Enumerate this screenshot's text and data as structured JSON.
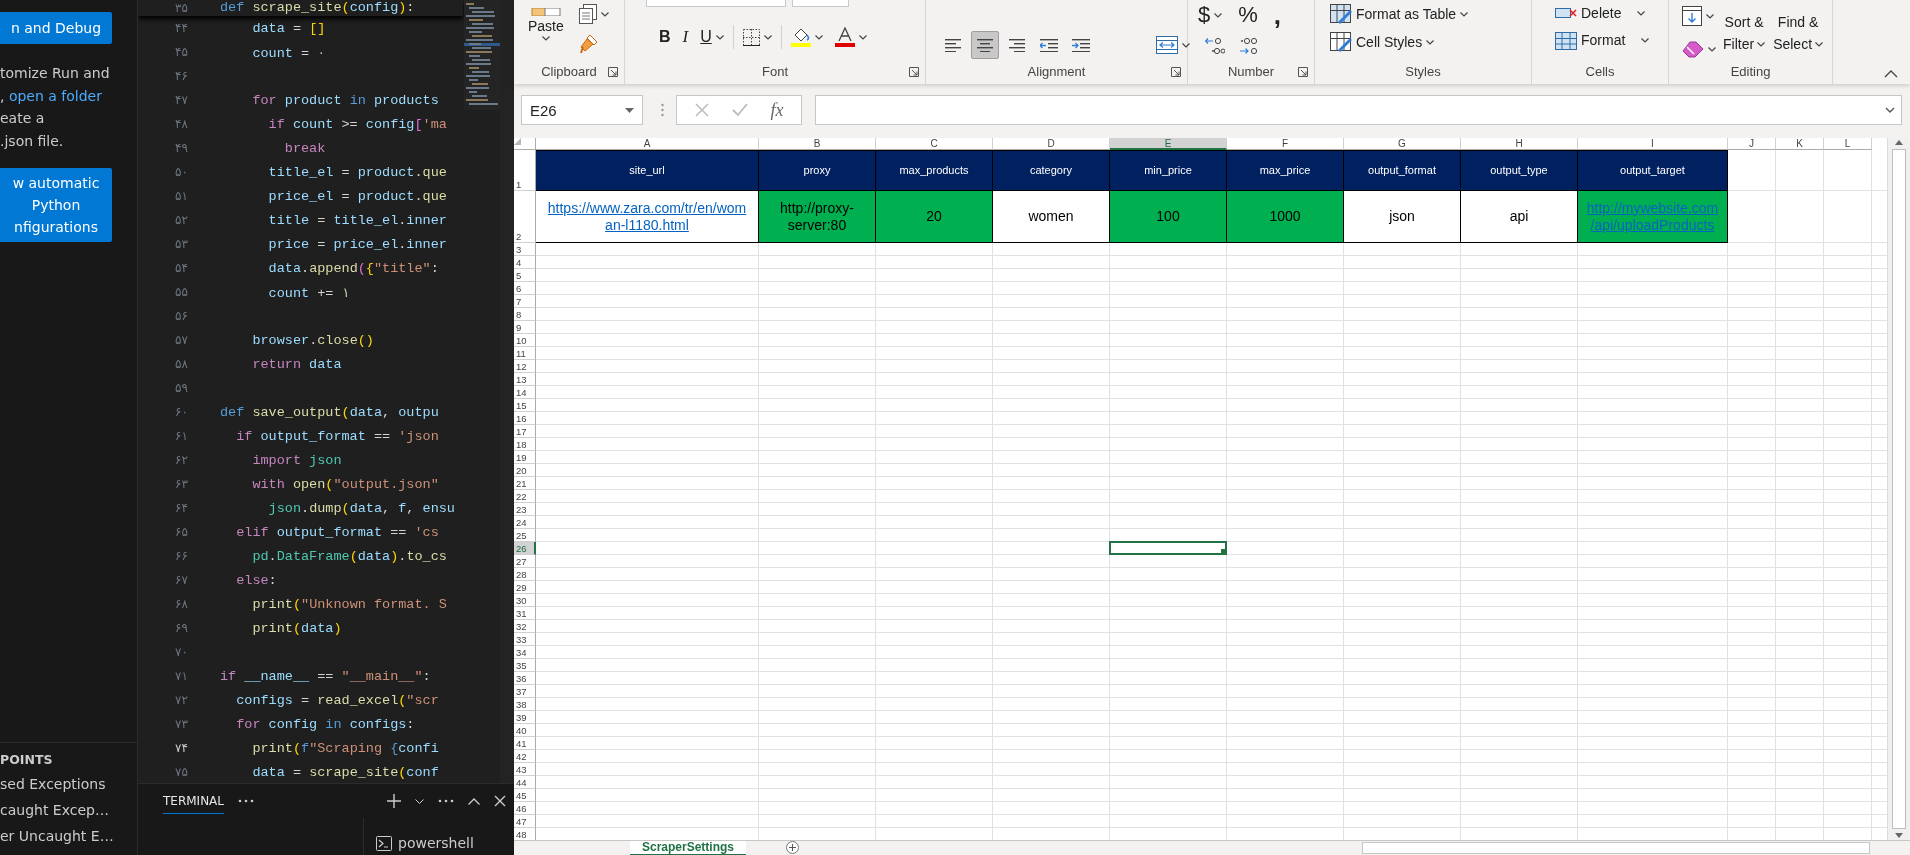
{
  "vscode": {
    "sidebar": {
      "buttons": [
        {
          "lines": [
            "n and Debug"
          ]
        },
        {
          "lines": [
            "w automatic",
            "Python",
            "nfigurations"
          ]
        }
      ],
      "help_text": [
        [
          {
            "kind": "text",
            "text": "tomize Run and"
          }
        ],
        [
          {
            "kind": "text",
            "text": ", "
          },
          {
            "kind": "link",
            "text": "open a folder"
          }
        ],
        [
          {
            "kind": "text",
            "text": "eate a"
          }
        ],
        [
          {
            "kind": "text",
            "text": ".json file."
          }
        ]
      ],
      "breakpoints": {
        "header": "POINTS",
        "items": [
          "sed Exceptions",
          "caught Excep…",
          "er Uncaught E…"
        ]
      }
    },
    "editor": {
      "sticky": {
        "number": "۳۵",
        "tokens": [
          {
            "kind": "kw",
            "text": "def"
          },
          {
            "kind": "fn",
            "text": " scrape_site"
          },
          {
            "kind": "br1",
            "text": "("
          },
          {
            "kind": "var",
            "text": "config"
          },
          {
            "kind": "br1",
            "text": ")"
          },
          {
            "kind": "op",
            "text": ":"
          }
        ]
      },
      "lines": [
        {
          "number": "۴۴",
          "current": false,
          "tokens": [
            {
              "kind": "var",
              "text": "    data"
            },
            {
              "kind": "op",
              "text": " = "
            },
            {
              "kind": "br1",
              "text": "[]"
            }
          ]
        },
        {
          "number": "۴۵",
          "current": false,
          "tokens": [
            {
              "kind": "var",
              "text": "    count"
            },
            {
              "kind": "op",
              "text": " = "
            },
            {
              "kind": "num",
              "text": "۰"
            }
          ]
        },
        {
          "number": "۴۶",
          "current": false
        },
        {
          "number": "۴۷",
          "current": false,
          "tokens": [
            {
              "kind": "ctl",
              "text": "    for"
            },
            {
              "kind": "var",
              "text": " product"
            },
            {
              "kind": "kw",
              "text": " in"
            },
            {
              "kind": "var",
              "text": " products"
            }
          ]
        },
        {
          "number": "۴۸",
          "current": false,
          "tokens": [
            {
              "kind": "ctl",
              "text": "      if"
            },
            {
              "kind": "var",
              "text": " count"
            },
            {
              "kind": "op",
              "text": " >= "
            },
            {
              "kind": "var",
              "text": "config"
            },
            {
              "kind": "br2",
              "text": "["
            },
            {
              "kind": "str",
              "text": "'ma"
            }
          ]
        },
        {
          "number": "۴۹",
          "current": false,
          "tokens": [
            {
              "kind": "ctl",
              "text": "        break"
            }
          ]
        },
        {
          "number": "۵۰",
          "current": false,
          "tokens": [
            {
              "kind": "var",
              "text": "      title_el"
            },
            {
              "kind": "op",
              "text": " = "
            },
            {
              "kind": "var",
              "text": "product"
            },
            {
              "kind": "op",
              "text": "."
            },
            {
              "kind": "fn",
              "text": "que"
            }
          ]
        },
        {
          "number": "۵۱",
          "current": false,
          "tokens": [
            {
              "kind": "var",
              "text": "      price_el"
            },
            {
              "kind": "op",
              "text": " = "
            },
            {
              "kind": "var",
              "text": "product"
            },
            {
              "kind": "op",
              "text": "."
            },
            {
              "kind": "fn",
              "text": "que"
            }
          ]
        },
        {
          "number": "۵۲",
          "current": false,
          "tokens": [
            {
              "kind": "var",
              "text": "      title"
            },
            {
              "kind": "op",
              "text": " = "
            },
            {
              "kind": "var",
              "text": "title_el"
            },
            {
              "kind": "op",
              "text": "."
            },
            {
              "kind": "var",
              "text": "inner"
            }
          ]
        },
        {
          "number": "۵۳",
          "current": false,
          "tokens": [
            {
              "kind": "var",
              "text": "      price"
            },
            {
              "kind": "op",
              "text": " = "
            },
            {
              "kind": "var",
              "text": "price_el"
            },
            {
              "kind": "op",
              "text": "."
            },
            {
              "kind": "var",
              "text": "inner"
            }
          ]
        },
        {
          "number": "۵۴",
          "current": false,
          "tokens": [
            {
              "kind": "var",
              "text": "      data"
            },
            {
              "kind": "op",
              "text": "."
            },
            {
              "kind": "fn",
              "text": "append"
            },
            {
              "kind": "br2",
              "text": "("
            },
            {
              "kind": "br1",
              "text": "{"
            },
            {
              "kind": "str",
              "text": "\"title\""
            },
            {
              "kind": "op",
              "text": ":"
            }
          ]
        },
        {
          "number": "۵۵",
          "current": false,
          "tokens": [
            {
              "kind": "var",
              "text": "      count"
            },
            {
              "kind": "op",
              "text": " += "
            },
            {
              "kind": "num",
              "text": "۱"
            }
          ]
        },
        {
          "number": "۵۶",
          "current": false
        },
        {
          "number": "۵۷",
          "current": false,
          "tokens": [
            {
              "kind": "var",
              "text": "    browser"
            },
            {
              "kind": "op",
              "text": "."
            },
            {
              "kind": "fn",
              "text": "close"
            },
            {
              "kind": "br1",
              "text": "()"
            }
          ]
        },
        {
          "number": "۵۸",
          "current": false,
          "tokens": [
            {
              "kind": "ctl",
              "text": "    return"
            },
            {
              "kind": "var",
              "text": " data"
            }
          ]
        },
        {
          "number": "۵۹",
          "current": false
        },
        {
          "number": "۶۰",
          "current": false,
          "tokens": [
            {
              "kind": "kw",
              "text": "def"
            },
            {
              "kind": "fn",
              "text": " save_output"
            },
            {
              "kind": "br1",
              "text": "("
            },
            {
              "kind": "var",
              "text": "data"
            },
            {
              "kind": "op",
              "text": ", "
            },
            {
              "kind": "var",
              "text": "outpu"
            }
          ]
        },
        {
          "number": "۶۱",
          "current": false,
          "tokens": [
            {
              "kind": "ctl",
              "text": "  if"
            },
            {
              "kind": "var",
              "text": " output_format"
            },
            {
              "kind": "op",
              "text": " == "
            },
            {
              "kind": "str",
              "text": "'json"
            }
          ]
        },
        {
          "number": "۶۲",
          "current": false,
          "tokens": [
            {
              "kind": "ctl",
              "text": "    import"
            },
            {
              "kind": "cls",
              "text": " json"
            }
          ]
        },
        {
          "number": "۶۳",
          "current": false,
          "tokens": [
            {
              "kind": "ctl",
              "text": "    with"
            },
            {
              "kind": "fn",
              "text": " open"
            },
            {
              "kind": "br1",
              "text": "("
            },
            {
              "kind": "str",
              "text": "\"output.json\""
            }
          ]
        },
        {
          "number": "۶۴",
          "current": false,
          "tokens": [
            {
              "kind": "cls",
              "text": "      json"
            },
            {
              "kind": "op",
              "text": "."
            },
            {
              "kind": "fn",
              "text": "dump"
            },
            {
              "kind": "br1",
              "text": "("
            },
            {
              "kind": "var",
              "text": "data"
            },
            {
              "kind": "op",
              "text": ", "
            },
            {
              "kind": "var",
              "text": "f"
            },
            {
              "kind": "op",
              "text": ", "
            },
            {
              "kind": "var",
              "text": "ensu"
            }
          ]
        },
        {
          "number": "۶۵",
          "current": false,
          "tokens": [
            {
              "kind": "ctl",
              "text": "  elif"
            },
            {
              "kind": "var",
              "text": " output_format"
            },
            {
              "kind": "op",
              "text": " == "
            },
            {
              "kind": "str",
              "text": "'cs"
            }
          ]
        },
        {
          "number": "۶۶",
          "current": false,
          "tokens": [
            {
              "kind": "cls",
              "text": "    pd"
            },
            {
              "kind": "op",
              "text": "."
            },
            {
              "kind": "cls",
              "text": "DataFrame"
            },
            {
              "kind": "br1",
              "text": "("
            },
            {
              "kind": "var",
              "text": "data"
            },
            {
              "kind": "br1",
              "text": ")"
            },
            {
              "kind": "op",
              "text": "."
            },
            {
              "kind": "fn",
              "text": "to_cs"
            }
          ]
        },
        {
          "number": "۶۷",
          "current": false,
          "tokens": [
            {
              "kind": "ctl",
              "text": "  else"
            },
            {
              "kind": "op",
              "text": ":"
            }
          ]
        },
        {
          "number": "۶۸",
          "current": false,
          "tokens": [
            {
              "kind": "fn",
              "text": "    print"
            },
            {
              "kind": "br1",
              "text": "("
            },
            {
              "kind": "str",
              "text": "\"Unknown format. S"
            }
          ]
        },
        {
          "number": "۶۹",
          "current": false,
          "tokens": [
            {
              "kind": "fn",
              "text": "    print"
            },
            {
              "kind": "br1",
              "text": "("
            },
            {
              "kind": "var",
              "text": "data"
            },
            {
              "kind": "br1",
              "text": ")"
            }
          ]
        },
        {
          "number": "۷۰",
          "current": false
        },
        {
          "number": "۷۱",
          "current": false,
          "tokens": [
            {
              "kind": "ctl",
              "text": "if"
            },
            {
              "kind": "var",
              "text": " __name__"
            },
            {
              "kind": "op",
              "text": " == "
            },
            {
              "kind": "str",
              "text": "\"__main__\""
            },
            {
              "kind": "op",
              "text": ":"
            }
          ]
        },
        {
          "number": "۷۲",
          "current": false,
          "tokens": [
            {
              "kind": "var",
              "text": "  configs"
            },
            {
              "kind": "op",
              "text": " = "
            },
            {
              "kind": "fn",
              "text": "read_excel"
            },
            {
              "kind": "br1",
              "text": "("
            },
            {
              "kind": "str",
              "text": "\"scr"
            }
          ]
        },
        {
          "number": "۷۳",
          "current": false,
          "tokens": [
            {
              "kind": "ctl",
              "text": "  for"
            },
            {
              "kind": "var",
              "text": " config"
            },
            {
              "kind": "kw",
              "text": " in"
            },
            {
              "kind": "var",
              "text": " configs"
            },
            {
              "kind": "op",
              "text": ":"
            }
          ]
        },
        {
          "number": "۷۴",
          "current": true,
          "tokens": [
            {
              "kind": "fn",
              "text": "    print"
            },
            {
              "kind": "br1",
              "text": "("
            },
            {
              "kind": "kw",
              "text": "f"
            },
            {
              "kind": "str",
              "text": "\"Scraping "
            },
            {
              "kind": "kw",
              "text": "{"
            },
            {
              "kind": "var",
              "text": "confi"
            }
          ]
        },
        {
          "number": "۷۵",
          "current": false,
          "tokens": [
            {
              "kind": "var",
              "text": "    data"
            },
            {
              "kind": "op",
              "text": " = "
            },
            {
              "kind": "fn",
              "text": "scrape_site"
            },
            {
              "kind": "br1",
              "text": "("
            },
            {
              "kind": "var",
              "text": "conf"
            }
          ]
        }
      ]
    },
    "panel": {
      "tabs": [
        {
          "label": "TERMINAL",
          "selected": true
        }
      ],
      "sessions": [
        {
          "label": "powershell"
        }
      ]
    }
  },
  "excel": {
    "ribbon": [
      {
        "kind": "clipboard",
        "label": "Clipboard",
        "launcher": true,
        "paste": "Paste"
      },
      {
        "kind": "font",
        "label": "Font",
        "launcher": true,
        "buttons": [
          {
            "kind": "bold",
            "label": "B"
          },
          {
            "kind": "italic",
            "label": "I"
          },
          {
            "kind": "underline",
            "label": "U"
          }
        ]
      },
      {
        "kind": "alignment",
        "label": "Alignment",
        "launcher": true,
        "buttons": [
          {
            "kind": "left",
            "selected": false
          },
          {
            "kind": "center",
            "selected": true
          },
          {
            "kind": "right",
            "selected": false
          },
          {
            "kind": "outdent",
            "selected": false
          },
          {
            "kind": "indent",
            "selected": false
          }
        ]
      },
      {
        "kind": "number",
        "label": "Number",
        "launcher": true,
        "symbols": [
          {
            "kind": "currency",
            "label": "$"
          },
          {
            "kind": "percent",
            "label": "%"
          },
          {
            "kind": "comma",
            "label": ","
          }
        ]
      },
      {
        "kind": "styles",
        "label": "Styles",
        "launcher": false,
        "items": [
          {
            "kind": "table",
            "label": "Format as Table"
          },
          {
            "kind": "cell",
            "label": "Cell Styles"
          }
        ]
      },
      {
        "kind": "cells",
        "label": "Cells",
        "launcher": false,
        "items": [
          {
            "kind": "delete",
            "label": "Delete"
          },
          {
            "kind": "format",
            "label": "Format"
          }
        ]
      },
      {
        "kind": "editing",
        "label": "Editing",
        "launcher": false,
        "items": [
          {
            "lines": [
              "Sort &",
              "Filter"
            ]
          },
          {
            "lines": [
              "Find &",
              "Select"
            ]
          }
        ]
      }
    ],
    "name_box": "E26",
    "function_label": "fx",
    "sheet": {
      "columns": [
        {
          "label": "A",
          "selected": false
        },
        {
          "label": "B",
          "selected": false
        },
        {
          "label": "C",
          "selected": false
        },
        {
          "label": "D",
          "selected": false
        },
        {
          "label": "E",
          "selected": true
        },
        {
          "label": "F",
          "selected": false
        },
        {
          "label": "G",
          "selected": false
        },
        {
          "label": "H",
          "selected": false
        },
        {
          "label": "I",
          "selected": false
        },
        {
          "label": "J",
          "selected": false
        },
        {
          "label": "K",
          "selected": false
        },
        {
          "label": "L",
          "selected": false
        }
      ],
      "cells": [
        [
          {
            "kind": "header",
            "value": "site_url",
            "color": "#002060"
          },
          {
            "kind": "header",
            "value": "proxy",
            "color": "#002060"
          },
          {
            "kind": "header",
            "value": "max_products",
            "color": "#002060"
          },
          {
            "kind": "header",
            "value": "category",
            "color": "#002060"
          },
          {
            "kind": "header",
            "value": "min_price",
            "color": "#002060"
          },
          {
            "kind": "header",
            "value": "max_price",
            "color": "#002060"
          },
          {
            "kind": "header",
            "value": "output_format",
            "color": "#002060"
          },
          {
            "kind": "header",
            "value": "output_type",
            "color": "#002060"
          },
          {
            "kind": "header",
            "value": "output_target",
            "color": "#002060"
          }
        ],
        [
          {
            "kind": "link",
            "value": "https://www.zara.com/tr/en/woman-l1180.html",
            "color": "#ffffff"
          },
          {
            "kind": "text",
            "value": "http://proxy-server:80",
            "color": "#00b050"
          },
          {
            "kind": "text",
            "value": "20",
            "color": "#00b050"
          },
          {
            "kind": "text",
            "value": "women",
            "color": "#ffffff"
          },
          {
            "kind": "text",
            "value": "100",
            "color": "#00b050"
          },
          {
            "kind": "text",
            "value": "1000",
            "color": "#00b050"
          },
          {
            "kind": "text",
            "value": "json",
            "color": "#ffffff"
          },
          {
            "kind": "text",
            "value": "api",
            "color": "#ffffff"
          },
          {
            "kind": "link",
            "value": "http://mywebsite.com/api/uploadProducts",
            "color": "#00b050"
          }
        ]
      ],
      "rows": [
        {
          "label": "1",
          "selected": false
        },
        {
          "label": "2",
          "selected": false
        },
        {
          "label": "3",
          "selected": false
        },
        {
          "label": "4",
          "selected": false
        },
        {
          "label": "5",
          "selected": false
        },
        {
          "label": "6",
          "selected": false
        },
        {
          "label": "7",
          "selected": false
        },
        {
          "label": "8",
          "selected": false
        },
        {
          "label": "9",
          "selected": false
        },
        {
          "label": "10",
          "selected": false
        },
        {
          "label": "11",
          "selected": false
        },
        {
          "label": "12",
          "selected": false
        },
        {
          "label": "13",
          "selected": false
        },
        {
          "label": "14",
          "selected": false
        },
        {
          "label": "15",
          "selected": false
        },
        {
          "label": "16",
          "selected": false
        },
        {
          "label": "17",
          "selected": false
        },
        {
          "label": "18",
          "selected": false
        },
        {
          "label": "19",
          "selected": false
        },
        {
          "label": "20",
          "selected": false
        },
        {
          "label": "21",
          "selected": false
        },
        {
          "label": "22",
          "selected": false
        },
        {
          "label": "23",
          "selected": false
        },
        {
          "label": "24",
          "selected": false
        },
        {
          "label": "25",
          "selected": false
        },
        {
          "label": "26",
          "selected": true
        },
        {
          "label": "27",
          "selected": false
        },
        {
          "label": "28",
          "selected": false
        },
        {
          "label": "29",
          "selected": false
        },
        {
          "label": "30",
          "selected": false
        },
        {
          "label": "31",
          "selected": false
        },
        {
          "label": "32",
          "selected": false
        },
        {
          "label": "33",
          "selected": false
        },
        {
          "label": "34",
          "selected": false
        },
        {
          "label": "35",
          "selected": false
        },
        {
          "label": "36",
          "selected": false
        },
        {
          "label": "37",
          "selected": false
        },
        {
          "label": "38",
          "selected": false
        },
        {
          "label": "39",
          "selected": false
        },
        {
          "label": "40",
          "selected": false
        },
        {
          "label": "41",
          "selected": false
        },
        {
          "label": "42",
          "selected": false
        },
        {
          "label": "43",
          "selected": false
        },
        {
          "label": "44",
          "selected": false
        },
        {
          "label": "45",
          "selected": false
        },
        {
          "label": "46",
          "selected": false
        },
        {
          "label": "47",
          "selected": false
        },
        {
          "label": "48",
          "selected": false
        }
      ]
    },
    "sheet_tabs": [
      {
        "label": "ScraperSettings",
        "selected": true
      }
    ]
  }
}
